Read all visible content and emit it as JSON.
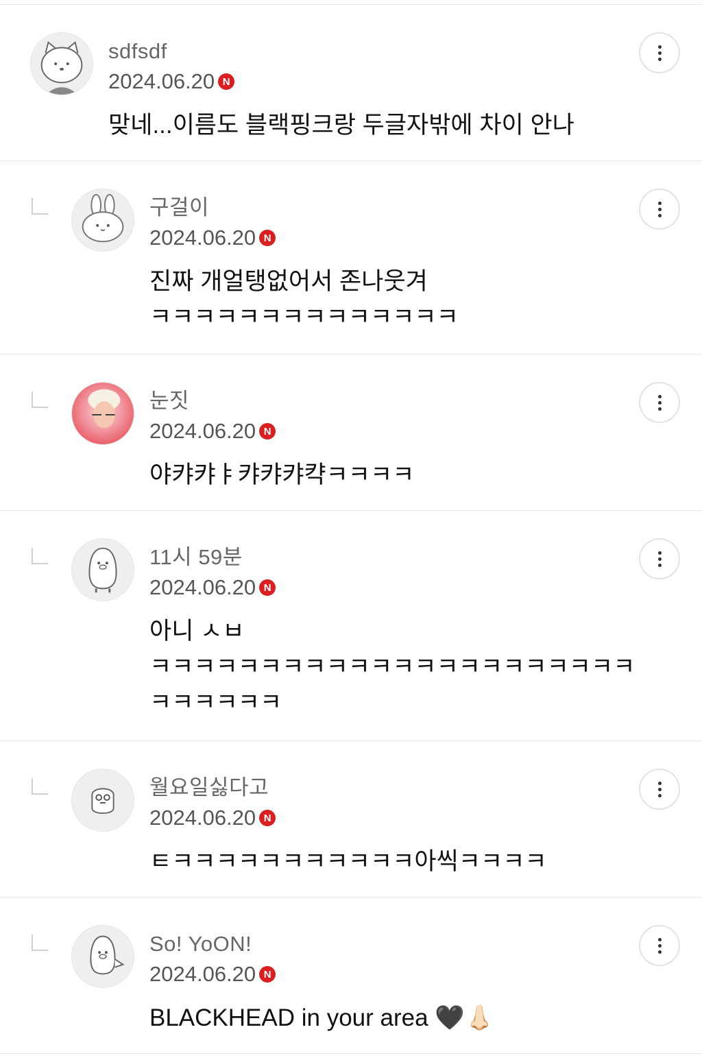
{
  "comments": [
    {
      "nickname": "sdfsdf",
      "date": "2024.06.20",
      "badge": "N",
      "text": "맞네...이름도 블랙핑크랑 두글자밖에 차이 안나",
      "avatar": "cat-avatar-icon",
      "reply": false
    },
    {
      "nickname": "구걸이",
      "date": "2024.06.20",
      "badge": "N",
      "text": "진짜 개얼탱없어서 존나웃겨\nㅋㅋㅋㅋㅋㅋㅋㅋㅋㅋㅋㅋㅋㅋ",
      "avatar": "bunny-avatar-icon",
      "reply": true
    },
    {
      "nickname": "눈짓",
      "date": "2024.06.20",
      "badge": "N",
      "text": "야캬캬ㅑ캬캬캬캭ㅋㅋㅋㅋ",
      "avatar": "photo-avatar-icon",
      "reply": true
    },
    {
      "nickname": "11시 59분",
      "date": "2024.06.20",
      "badge": "N",
      "text": "아니 ㅅㅂ\nㅋㅋㅋㅋㅋㅋㅋㅋㅋㅋㅋㅋㅋㅋㅋㅋㅋㅋㅋㅋㅋㅋ\nㅋㅋㅋㅋㅋㅋ",
      "avatar": "penguin-avatar-icon",
      "reply": true
    },
    {
      "nickname": "월요일싫다고",
      "date": "2024.06.20",
      "badge": "N",
      "text": "ㅌㅋㅋㅋㅋㅋㅋㅋㅋㅋㅋㅋ아씩ㅋㅋㅋㅋ",
      "avatar": "chick-avatar-icon",
      "reply": true
    },
    {
      "nickname": "So! YoON!",
      "date": "2024.06.20",
      "badge": "N",
      "text": "BLACKHEAD in your area 🖤👃🏻",
      "avatar": "penguin-avatar-icon",
      "reply": true
    }
  ],
  "colors": {
    "badge": "#d91f1f",
    "divider": "#e6e6e6",
    "nickname": "#666666"
  }
}
